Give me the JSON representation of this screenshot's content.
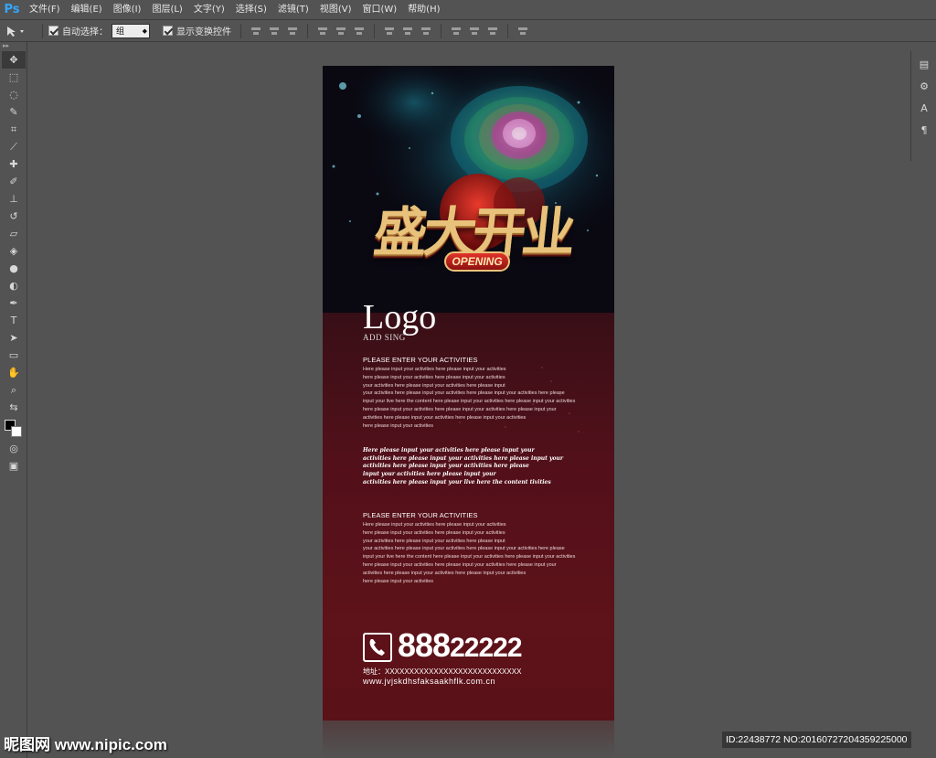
{
  "app": {
    "logo": "Ps",
    "menu": [
      "文件(F)",
      "编辑(E)",
      "图像(I)",
      "图层(L)",
      "文字(Y)",
      "选择(S)",
      "滤镜(T)",
      "视图(V)",
      "窗口(W)",
      "帮助(H)"
    ]
  },
  "options_bar": {
    "auto_select_label": "自动选择：",
    "auto_select_value": "组",
    "show_transform_label": "显示变换控件"
  },
  "poster": {
    "title_cn": "盛大开业",
    "badge": "OPENING",
    "logo": "Logo",
    "logo_sub": "ADD SING",
    "section1": {
      "title": "PLEASE ENTER YOUR ACTIVITIES",
      "lines": [
        "Here please input your activities here please input your activities",
        "here please input your activities here please input your activities",
        "your activities here please input your activities here please input",
        "your activities here please input your activities here please input your activities here please",
        "input your live here the content here please input your activities here please input your activities",
        "here please input your activities here please input your activities here please input your",
        " activities here please input your activities here please input your activities",
        "here please input your activities"
      ]
    },
    "script_lines": [
      "Here please input your activities here please input your",
      "activities here please input your activities here please input your",
      "activities here please input your activities here please",
      "input your activities here please input your",
      "activities here please input your live here the content tivities"
    ],
    "section2": {
      "title": "PLEASE ENTER YOUR ACTIVITIES",
      "lines": [
        "Here please input your activities here please input your activities",
        "here please input your activities here please input your activities",
        "your activities here please input your activities here please input",
        "your activities here please input your activities here please input your activities here please",
        "input your live here the content here please input your activities here please input your activities",
        "here please input your activities here please input your activities here please input your",
        " activities here please input your activities here please input your activities",
        "here please input your activities"
      ]
    },
    "phone_bold": "888",
    "phone_rest": "22222",
    "address": "地址：XXXXXXXXXXXXXXXXXXXXXXXXXXXX",
    "website": "www.jvjskdhsfaksaakhflk.com.cn"
  },
  "watermark": {
    "left": "昵图网 www.nipic.com",
    "right": "ID:22438772 NO:20160727204359225000"
  },
  "colors": {
    "ui_bg": "#535353",
    "poster_red": "#5e1219",
    "gold": "#e8c27a",
    "ps_blue": "#31a8ff"
  }
}
